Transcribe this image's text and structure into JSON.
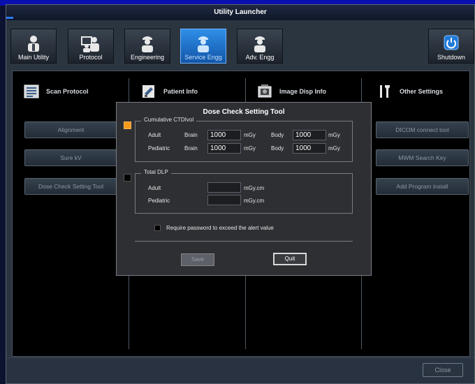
{
  "window": {
    "title": "Utility Launcher"
  },
  "toolbar": {
    "buttons": [
      {
        "label": "Main Utility",
        "icon": "user-icon",
        "active": false
      },
      {
        "label": "Protocol",
        "icon": "users-icon",
        "active": false
      },
      {
        "label": "Engineering",
        "icon": "engineer-icon",
        "active": false
      },
      {
        "label": "Service Engg",
        "icon": "service-engineer-icon",
        "active": true
      },
      {
        "label": "Adv. Engg",
        "icon": "advanced-engineer-icon",
        "active": false
      }
    ],
    "shutdown_label": "Shutdown"
  },
  "categories": [
    {
      "label": "Scan Protocol",
      "icon": "scan-protocol-icon"
    },
    {
      "label": "Patient Info",
      "icon": "patient-info-icon"
    },
    {
      "label": "Image Disp Info",
      "icon": "image-disp-icon"
    },
    {
      "label": "Other Settings",
      "icon": "wrench-icon"
    }
  ],
  "left_buttons": [
    "Alignment",
    "Sure kV",
    "Dose Check Setting Tool"
  ],
  "right_buttons": [
    "DICOM connect tool",
    "MWM Search Key",
    "Add Program install"
  ],
  "footer": {
    "close_label": "Close"
  },
  "dialog": {
    "title": "Dose Check Setting Tool",
    "ctdi": {
      "legend": "Cumulative CTDIvol",
      "checked": true,
      "adult_label": "Adult",
      "pediatric_label": "Pediatric",
      "brain_label": "Brain",
      "body_label": "Body",
      "unit": "mGy",
      "adult_brain": "1000",
      "adult_body": "1000",
      "pediatric_brain": "1000",
      "pediatric_body": "1000"
    },
    "dlp": {
      "legend": "Total DLP",
      "checked": false,
      "adult_label": "Adult",
      "pediatric_label": "Pediatric",
      "unit": "mGy.cm",
      "adult_value": "",
      "pediatric_value": ""
    },
    "password_label": "Require password to exceed the alert value",
    "password_checked": false,
    "save_label": "Save",
    "quit_label": "Quit"
  },
  "colors": {
    "accent": "#2a7cff",
    "active_button": "#1f7ad8",
    "checkbox_on": "#f39a1a"
  }
}
